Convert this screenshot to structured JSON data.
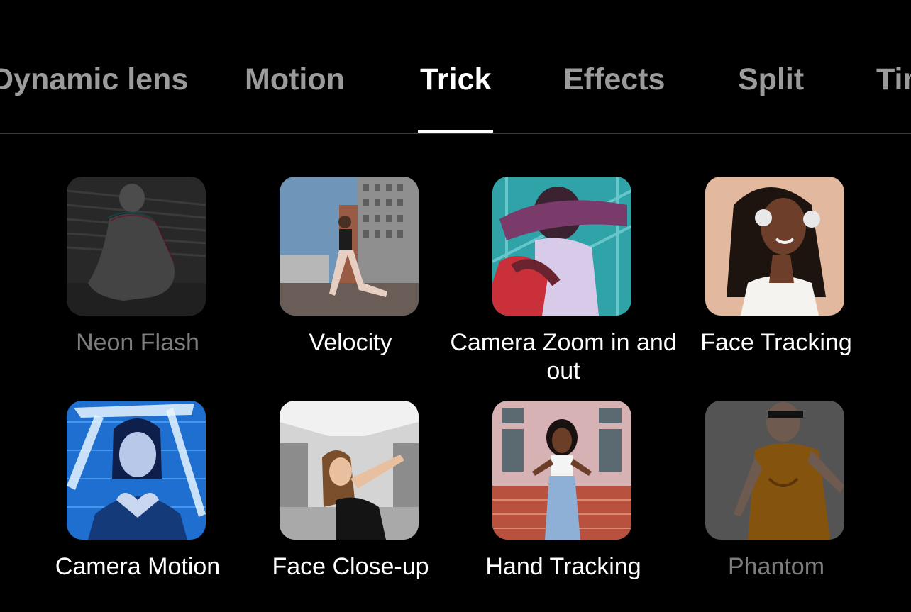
{
  "tabs": [
    {
      "label": "Dynamic lens",
      "active": false
    },
    {
      "label": "Motion",
      "active": false
    },
    {
      "label": "Trick",
      "active": true
    },
    {
      "label": "Effects",
      "active": false
    },
    {
      "label": "Split",
      "active": false
    },
    {
      "label": "Time",
      "active": false
    }
  ],
  "items": [
    {
      "label": "Neon Flash",
      "disabled": true,
      "thumb": "neon-flash-thumbnail"
    },
    {
      "label": "Velocity",
      "disabled": false,
      "thumb": "velocity-thumbnail"
    },
    {
      "label": "Camera Zoom in and out",
      "disabled": false,
      "thumb": "camera-zoom-thumbnail"
    },
    {
      "label": "Face Tracking",
      "disabled": false,
      "thumb": "face-tracking-thumbnail"
    },
    {
      "label": "Camera Motion",
      "disabled": false,
      "thumb": "camera-motion-thumbnail"
    },
    {
      "label": "Face Close-up",
      "disabled": false,
      "thumb": "face-close-up-thumbnail"
    },
    {
      "label": "Hand Tracking",
      "disabled": false,
      "thumb": "hand-tracking-thumbnail"
    },
    {
      "label": "Phantom",
      "disabled": true,
      "thumb": "phantom-thumbnail"
    }
  ],
  "colors": {
    "background": "#000000",
    "active_text": "#ffffff",
    "inactive_tab": "#9b9b9b",
    "disabled_label": "#7d7d7d"
  }
}
